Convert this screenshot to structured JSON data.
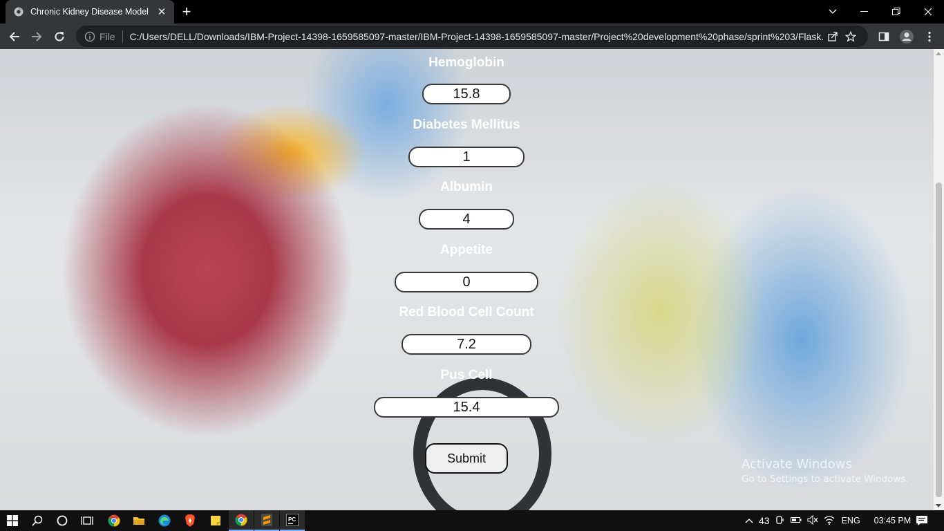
{
  "browser": {
    "tab_title": "Chronic Kidney Disease Model",
    "new_tab": "+",
    "file_label": "File",
    "url": "C:/Users/DELL/Downloads/IBM-Project-14398-1659585097-master/IBM-Project-14398-1659585097-master/Project%20development%20phase/sprint%203/Flask..."
  },
  "form": {
    "fields": [
      {
        "label": "Hemoglobin",
        "value": "15.8"
      },
      {
        "label": "Diabetes Mellitus",
        "value": "1"
      },
      {
        "label": "Albumin",
        "value": "4"
      },
      {
        "label": "Appetite",
        "value": "0"
      },
      {
        "label": "Red Blood Cell Count",
        "value": "7.2"
      },
      {
        "label": "Pus Cell",
        "value": "15.4"
      }
    ],
    "submit_label": "Submit"
  },
  "watermark": {
    "line1": "Activate Windows",
    "line2": "Go to Settings to activate Windows."
  },
  "taskbar": {
    "temperature": "43",
    "language": "ENG",
    "time": "03:45 PM"
  },
  "colors": {
    "chrome_dark": "#35363a",
    "tabstrip": "#000000",
    "label_text": "#ffffff",
    "taskbar": "#101010"
  },
  "icons": [
    "chrome-favicon-icon",
    "close-icon",
    "new-tab-icon",
    "minimize-icon",
    "restore-icon",
    "window-close-icon",
    "chevron-down-icon",
    "back-icon",
    "forward-icon",
    "reload-icon",
    "info-icon",
    "share-icon",
    "star-icon",
    "sidebar-icon",
    "profile-icon",
    "menu-icon",
    "windows-start-icon",
    "search-icon",
    "cortana-icon",
    "task-view-icon",
    "chrome-icon",
    "file-explorer-icon",
    "edge-icon",
    "brave-icon",
    "sticky-notes-icon",
    "sublime-icon",
    "pycharm-icon",
    "chevron-up-icon",
    "battery-icon",
    "volume-icon",
    "wifi-icon",
    "notification-icon"
  ]
}
